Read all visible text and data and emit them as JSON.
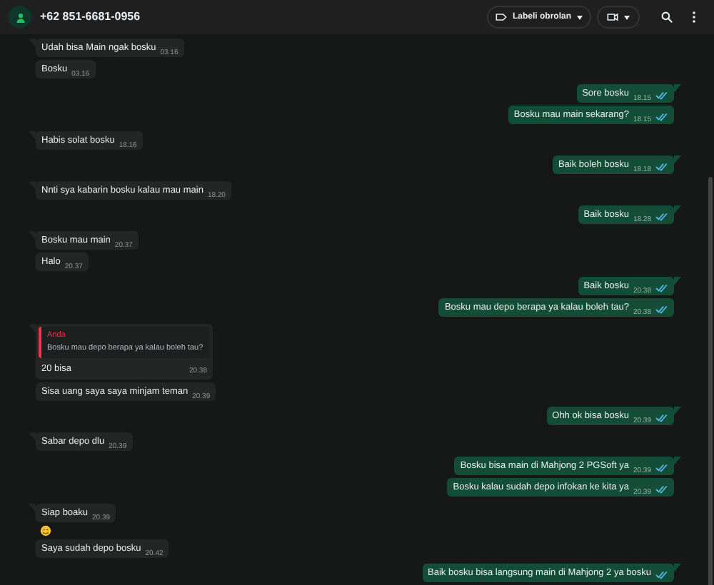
{
  "header": {
    "contact": "+62 851-6681-0956",
    "label_button": "Labeli obrolan"
  },
  "messages": [
    {
      "kind": "in",
      "first_in_group": true,
      "text": "Udah bisa Main ngak bosku",
      "time": "03.16"
    },
    {
      "kind": "in",
      "first_in_group": false,
      "text": "Bosku",
      "time": "03.16"
    },
    {
      "kind": "out",
      "first_in_group": true,
      "text": "Sore bosku",
      "time": "18.15",
      "read": true
    },
    {
      "kind": "out",
      "first_in_group": false,
      "text": "Bosku mau main sekarang?",
      "time": "18.15",
      "read": true
    },
    {
      "kind": "in",
      "first_in_group": true,
      "text": "Habis solat bosku",
      "time": "18.16"
    },
    {
      "kind": "out",
      "first_in_group": true,
      "text": "Baik boleh bosku",
      "time": "18.18",
      "read": true
    },
    {
      "kind": "in",
      "first_in_group": true,
      "text": "Nnti sya kabarin bosku kalau mau main",
      "time": "18.20"
    },
    {
      "kind": "out",
      "first_in_group": true,
      "text": "Baik bosku",
      "time": "18.28",
      "read": true
    },
    {
      "kind": "in",
      "first_in_group": true,
      "text": "Bosku mau main",
      "time": "20.37"
    },
    {
      "kind": "in",
      "first_in_group": false,
      "text": "Halo",
      "time": "20.37"
    },
    {
      "kind": "out",
      "first_in_group": true,
      "text": "Baik bosku",
      "time": "20.38",
      "read": true
    },
    {
      "kind": "out",
      "first_in_group": false,
      "text": "Bosku mau depo berapa ya kalau boleh tau?",
      "time": "20.38",
      "read": true
    },
    {
      "kind": "reply",
      "first_in_group": true,
      "quote_author": "Anda",
      "quote_text": "Bosku mau depo berapa ya kalau boleh tau?",
      "text": "20 bisa",
      "time": "20.38"
    },
    {
      "kind": "in",
      "first_in_group": false,
      "text": "Sisa uang saya saya minjam teman",
      "time": "20.39"
    },
    {
      "kind": "out",
      "first_in_group": true,
      "text": "Ohh ok bisa bosku",
      "time": "20.39",
      "read": true
    },
    {
      "kind": "in",
      "first_in_group": true,
      "text": "Sabar depo dlu",
      "time": "20.39"
    },
    {
      "kind": "out",
      "first_in_group": true,
      "text": "Bosku bisa main di Mahjong 2 PGSoft ya",
      "time": "20.39",
      "read": true
    },
    {
      "kind": "out",
      "first_in_group": false,
      "text": "Bosku kalau sudah depo infokan ke kita ya",
      "time": "20.39",
      "read": true
    },
    {
      "kind": "in",
      "first_in_group": true,
      "text": "Siap boaku",
      "time": "20.39"
    },
    {
      "kind": "emoji"
    },
    {
      "kind": "in",
      "first_in_group": false,
      "text": "Saya sudah depo bosku",
      "time": "20.42"
    },
    {
      "kind": "out",
      "first_in_group": true,
      "text": "Baik bosku bisa langsung main di Mahjong 2 ya bosku",
      "read": true
    }
  ]
}
